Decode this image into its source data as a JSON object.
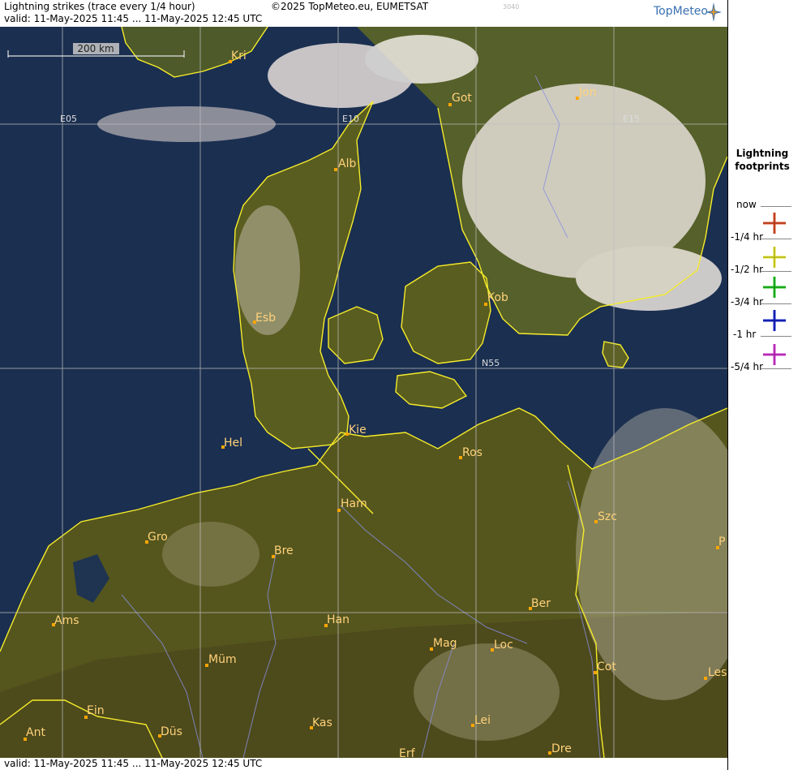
{
  "header": {
    "title": "Lightning strikes (trace every 1/4 hour)",
    "copyright": "©2025 TopMeteo.eu, EUMETSAT",
    "code": "3040",
    "valid": "valid:  11-May-2025 11:45 ... 11-May-2025 12:45 UTC",
    "logo": "TopMeteo"
  },
  "footer": {
    "valid": "valid:  11-May-2025 11:45 ... 11-May-2025 12:45 UTC"
  },
  "scale": {
    "label": "200 km"
  },
  "grid": {
    "lon_labels": [
      "E05",
      "E10",
      "E15"
    ],
    "lat_labels": [
      "N55"
    ]
  },
  "cities": [
    {
      "label": "Kri"
    },
    {
      "label": "Got"
    },
    {
      "label": "Jon"
    },
    {
      "label": "Alb"
    },
    {
      "label": "Esb"
    },
    {
      "label": "Kob"
    },
    {
      "label": "Kie"
    },
    {
      "label": "Hel"
    },
    {
      "label": "Ros"
    },
    {
      "label": "Ham"
    },
    {
      "label": "Szc"
    },
    {
      "label": "Gro"
    },
    {
      "label": "Bre"
    },
    {
      "label": "P"
    },
    {
      "label": "Ber"
    },
    {
      "label": "Ams"
    },
    {
      "label": "Han"
    },
    {
      "label": "Mag"
    },
    {
      "label": "Loc"
    },
    {
      "label": "Müm"
    },
    {
      "label": "Cot"
    },
    {
      "label": "Les"
    },
    {
      "label": "Ein"
    },
    {
      "label": "Kas"
    },
    {
      "label": "Lei"
    },
    {
      "label": "Ant"
    },
    {
      "label": "Düs"
    },
    {
      "label": "Dre"
    },
    {
      "label": "Erf"
    }
  ],
  "legend": {
    "title_line1": "Lightning",
    "title_line2": "footprints",
    "items": [
      {
        "label": "now"
      },
      {
        "label": "-1/4 hr",
        "color": "#e0502a"
      },
      {
        "label": "-1/2 hr",
        "color": "#e6e62a"
      },
      {
        "label": "-3/4 hr",
        "color": "#22c822"
      },
      {
        "label": "-1 hr",
        "color": "#1a2ad0"
      },
      {
        "label": "-5/4 hr",
        "color": "#d43ad4"
      }
    ]
  },
  "colors": {
    "sea": "#1a2e4e",
    "land": "#5a5c1c",
    "border": "#f5ec2a",
    "rivers": "#8088d8",
    "cities": "#ffa500"
  }
}
